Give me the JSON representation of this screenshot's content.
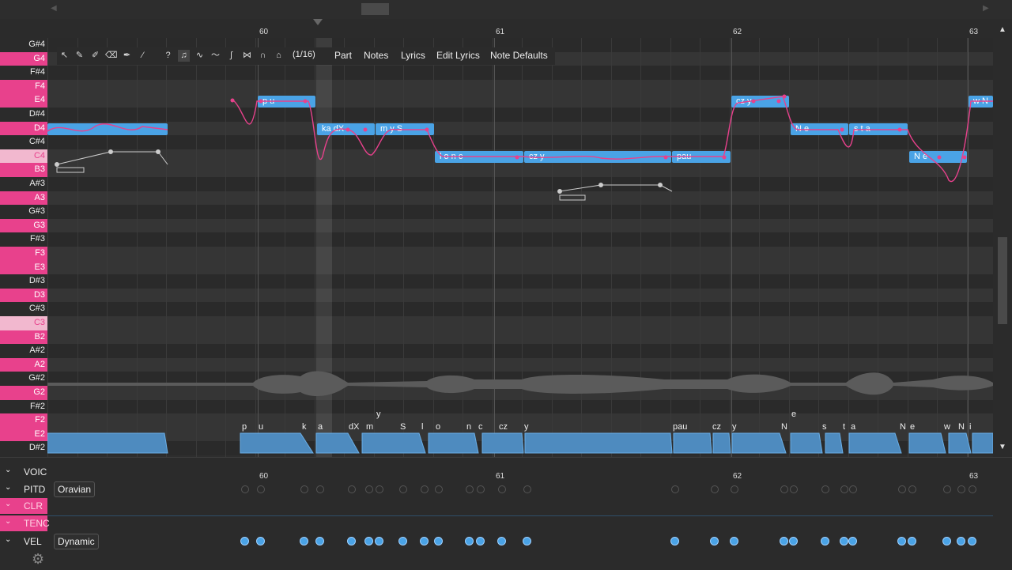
{
  "scroll": {
    "left_arrow": "◀",
    "right_arrow": "▶",
    "up_arrow": "▲",
    "down_arrow": "▼"
  },
  "bars": [
    "60",
    "61",
    "62",
    "63"
  ],
  "keys": [
    "G#4",
    "G4",
    "F#4",
    "F4",
    "E4",
    "D#4",
    "D4",
    "C#4",
    "C4",
    "B3",
    "A#3",
    "A3",
    "G#3",
    "G3",
    "F#3",
    "F3",
    "E3",
    "D#3",
    "D3",
    "C#3",
    "C3",
    "B3_2",
    "A#2",
    "A2",
    "G#2",
    "G2",
    "F#2",
    "F2",
    "E2",
    "D#2"
  ],
  "key_labels": [
    "G#4",
    "G4",
    "F#4",
    "F4",
    "E4",
    "D#4",
    "D4",
    "C#4",
    "C4",
    "B3",
    "A#3",
    "A3",
    "G#3",
    "G3",
    "F#3",
    "F3",
    "E3",
    "D#3",
    "D3",
    "C#3",
    "C3",
    "B2",
    "A#2",
    "A2",
    "G#2",
    "G2",
    "F#2",
    "F2",
    "E2",
    "D#2"
  ],
  "toolbar": {
    "snap": "(1/16)",
    "help": "?",
    "menu": [
      "Part",
      "Notes",
      "Lyrics",
      "Edit Lyrics",
      "Note Defaults"
    ]
  },
  "notes": [
    "p u",
    "ka dX",
    "m y S",
    "l o n c",
    "cz y",
    "pau",
    "cz y",
    "N e",
    "s t a",
    "N e",
    "w N"
  ],
  "phonemes": [
    "p",
    "u",
    "k",
    "a",
    "dX",
    "m",
    "S",
    "l",
    "o",
    "n",
    "c",
    "cz",
    "y",
    "pau",
    "cz",
    "y",
    "N",
    "s",
    "t",
    "a",
    "N",
    "e",
    "w",
    "N",
    "i"
  ],
  "phoneme_upper": [
    "y",
    "e"
  ],
  "expressions": {
    "rows": [
      {
        "label": "VOIC",
        "chev": "⌄"
      },
      {
        "label": "PITD",
        "chev": "⌄",
        "option": "Oravian"
      },
      {
        "label": "CLR",
        "chev": "⌄"
      },
      {
        "label": "TENC",
        "chev": "⌄"
      },
      {
        "label": "VEL",
        "chev": "⌄",
        "option": "Dynamic"
      }
    ],
    "settings_icon": "⚙"
  },
  "colors": {
    "accent": "#e8418c",
    "note": "#4aa3e6"
  }
}
